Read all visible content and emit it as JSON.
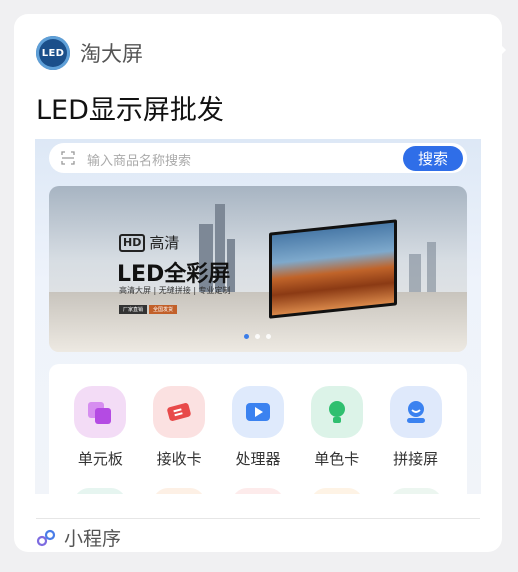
{
  "brand": {
    "name": "淘大屏",
    "logo_text": "LED"
  },
  "card_title": "LED显示屏批发",
  "search": {
    "placeholder": "输入商品名称搜索",
    "button": "搜索"
  },
  "banner": {
    "hd_badge": "HD",
    "hd_text": "高清",
    "headline": "LED全彩屏",
    "subline": "高清大屏 | 无缝拼接 | 专业定制",
    "chips": [
      "厂家直销",
      "全国发货"
    ],
    "active_slide": 1,
    "slide_count": 3
  },
  "categories": [
    {
      "label": "单元板",
      "icon": "unit-board-icon",
      "color": "#f3dcf6",
      "accent": "#b44be3"
    },
    {
      "label": "接收卡",
      "icon": "receiving-card-icon",
      "color": "#fbe1e1",
      "accent": "#e84a4a"
    },
    {
      "label": "处理器",
      "icon": "processor-icon",
      "color": "#dfeafc",
      "accent": "#3b82f0"
    },
    {
      "label": "单色卡",
      "icon": "mono-card-icon",
      "color": "#dcf3e8",
      "accent": "#2fbf6f"
    },
    {
      "label": "拼接屏",
      "icon": "splice-screen-icon",
      "color": "#dfe9fb",
      "accent": "#3b82f0"
    }
  ],
  "footer": {
    "label": "小程序"
  }
}
